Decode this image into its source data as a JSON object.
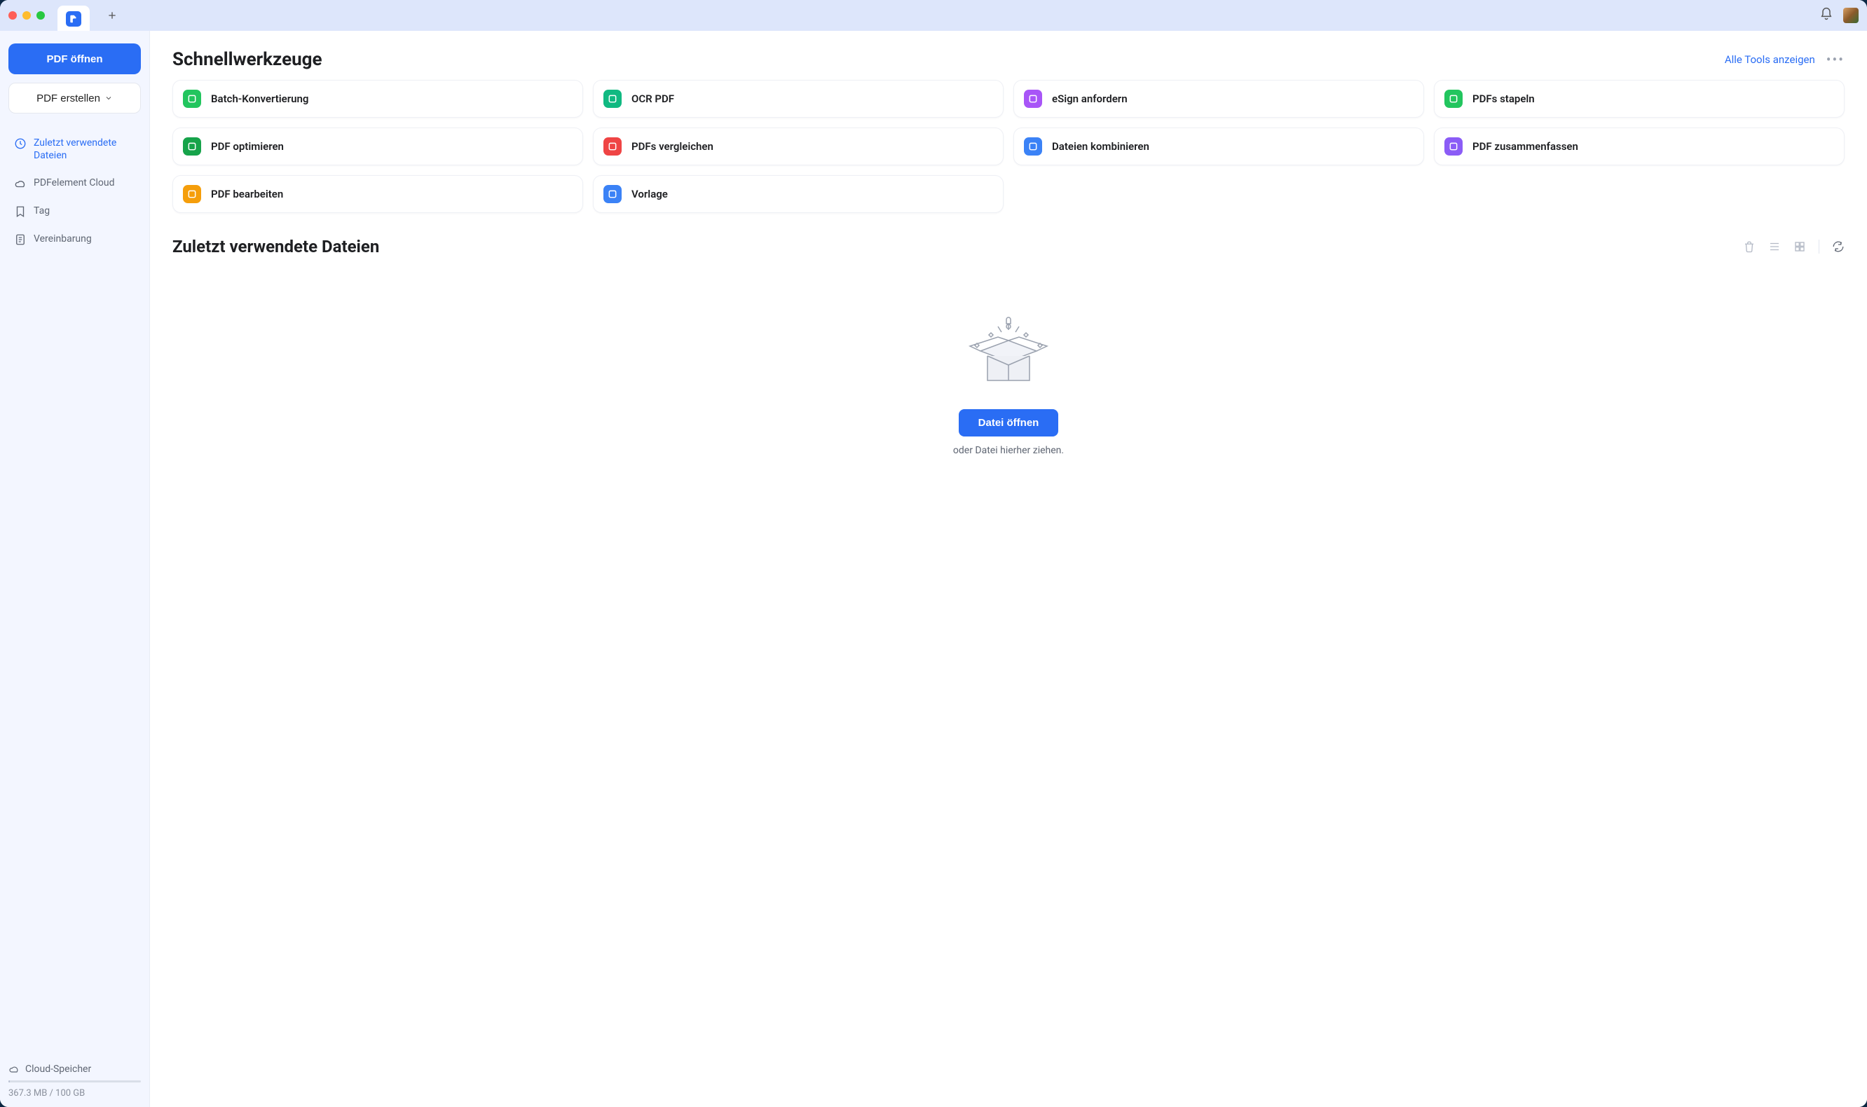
{
  "sidebar": {
    "open_pdf": "PDF öffnen",
    "create_pdf": "PDF erstellen",
    "nav": [
      {
        "id": "recent",
        "label": "Zuletzt verwendete Dateien",
        "active": true
      },
      {
        "id": "cloud",
        "label": "PDFelement Cloud"
      },
      {
        "id": "tag",
        "label": "Tag"
      },
      {
        "id": "agreement",
        "label": "Vereinbarung"
      }
    ],
    "cloud_storage_label": "Cloud-Speicher",
    "quota": "367.3 MB / 100 GB"
  },
  "quick_tools": {
    "title": "Schnellwerkzeuge",
    "show_all": "Alle Tools anzeigen",
    "tools": [
      {
        "id": "batch-convert",
        "label": "Batch-Konvertierung",
        "color": "#22c55e"
      },
      {
        "id": "ocr-pdf",
        "label": "OCR PDF",
        "color": "#10b981"
      },
      {
        "id": "esign",
        "label": "eSign anfordern",
        "color": "#a855f7"
      },
      {
        "id": "stack",
        "label": "PDFs stapeln",
        "color": "#22c55e"
      },
      {
        "id": "optimize",
        "label": "PDF optimieren",
        "color": "#16a34a"
      },
      {
        "id": "compare",
        "label": "PDFs vergleichen",
        "color": "#ef4444"
      },
      {
        "id": "combine",
        "label": "Dateien kombinieren",
        "color": "#3b82f6"
      },
      {
        "id": "summarize",
        "label": "PDF zusammenfassen",
        "color": "#8b5cf6"
      },
      {
        "id": "edit",
        "label": "PDF bearbeiten",
        "color": "#f59e0b"
      },
      {
        "id": "template",
        "label": "Vorlage",
        "color": "#3b82f6"
      }
    ]
  },
  "recent": {
    "title": "Zuletzt verwendete Dateien",
    "open_button": "Datei öffnen",
    "drop_hint": "oder Datei hierher ziehen."
  }
}
